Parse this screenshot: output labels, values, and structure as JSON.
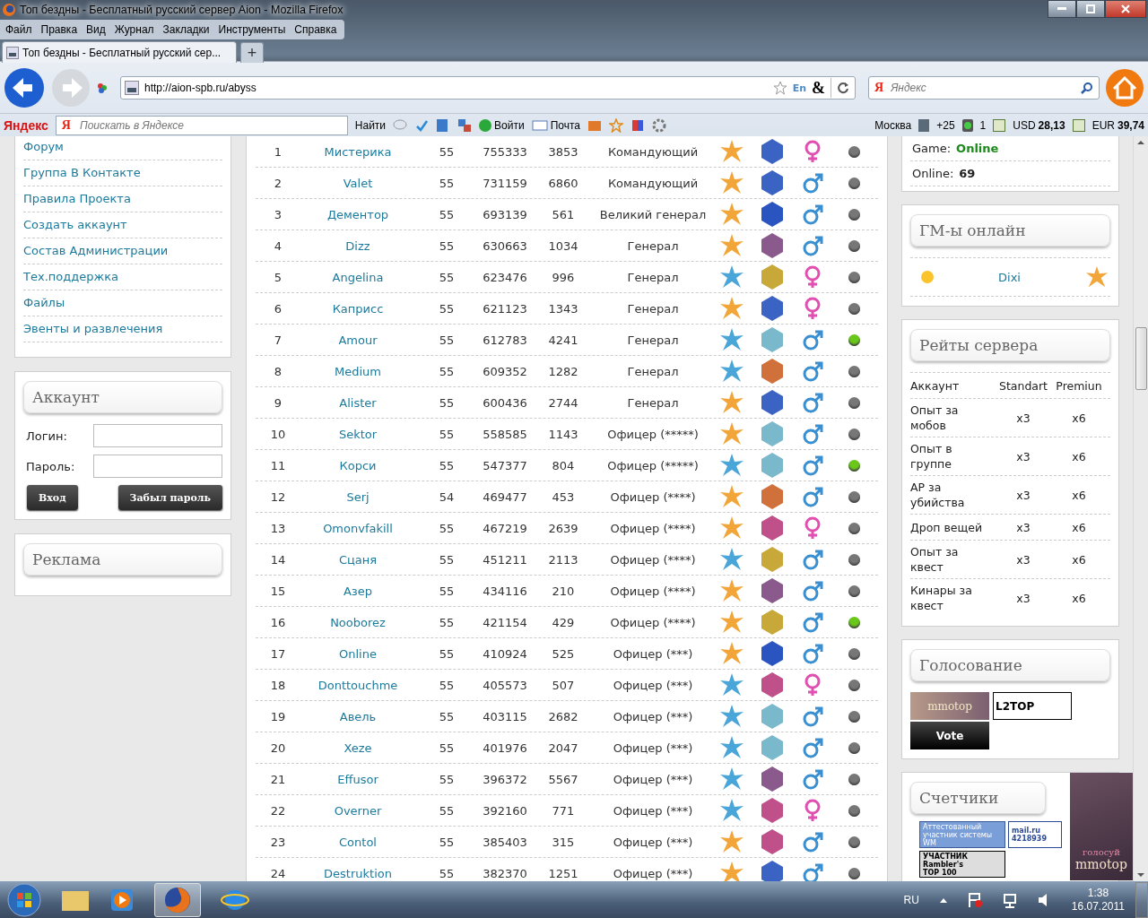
{
  "window": {
    "title": "Топ бездны - Бесплатный русский сервер Aion - Mozilla Firefox"
  },
  "menu": [
    "Файл",
    "Правка",
    "Вид",
    "Журнал",
    "Закладки",
    "Инструменты",
    "Справка"
  ],
  "tabs": [
    {
      "label": "Топ бездны - Бесплатный русский сер...",
      "selected": true
    }
  ],
  "new_tab": "+",
  "address": {
    "value": "http://aion-spb.ru/abyss",
    "lang": "En",
    "amp": "&"
  },
  "search": {
    "placeholder": "Яндекс",
    "logo": "Я"
  },
  "yandex_bar": {
    "logo": "Яндекс",
    "logo_letter": "Я",
    "search_placeholder": "Поискать в Яндексе",
    "find": "Найти",
    "login": "Войти",
    "mail": "Почта",
    "city": "Москва",
    "temp": "+25",
    "traffic": "1",
    "usd_label": "USD",
    "usd": "28,13",
    "eur_label": "EUR",
    "eur": "39,74"
  },
  "nav_links": [
    "Форум",
    "Группа В Контакте",
    "Правила Проекта",
    "Создать аккаунт",
    "Состав Администрации",
    "Тех.поддержка",
    "Файлы",
    "Эвенты и развлечения"
  ],
  "login_box": {
    "title": "Аккаунт",
    "login_label": "Логин:",
    "password_label": "Пароль:",
    "login_button": "Вход",
    "forgot_button": "Забыл пароль"
  },
  "ads_box": {
    "title": "Реклама"
  },
  "table": {
    "rows": [
      {
        "rank": "1",
        "name": "Мистерика",
        "level": "55",
        "ap": "755333",
        "kills": "3853",
        "title": "Командующий",
        "light_side": true,
        "color": "#3b63c4",
        "female": true,
        "online": false
      },
      {
        "rank": "2",
        "name": "Valet",
        "level": "55",
        "ap": "731159",
        "kills": "6860",
        "title": "Командующий",
        "light_side": true,
        "color": "#3b63c4",
        "female": false,
        "online": false
      },
      {
        "rank": "3",
        "name": "Дементор",
        "level": "55",
        "ap": "693139",
        "kills": "561",
        "title": "Великий генерал",
        "light_side": true,
        "color": "#2a55c0",
        "female": false,
        "online": false
      },
      {
        "rank": "4",
        "name": "Dizz",
        "level": "55",
        "ap": "630663",
        "kills": "1034",
        "title": "Генерал",
        "light_side": true,
        "color": "#8a5a8c",
        "female": false,
        "online": false
      },
      {
        "rank": "5",
        "name": "Angelina",
        "level": "55",
        "ap": "623476",
        "kills": "996",
        "title": "Генерал",
        "light_side": false,
        "color": "#c9a83a",
        "female": true,
        "online": false
      },
      {
        "rank": "6",
        "name": "Каприсс",
        "level": "55",
        "ap": "621123",
        "kills": "1343",
        "title": "Генерал",
        "light_side": true,
        "color": "#3b63c4",
        "female": true,
        "online": false
      },
      {
        "rank": "7",
        "name": "Amour",
        "level": "55",
        "ap": "612783",
        "kills": "4241",
        "title": "Генерал",
        "light_side": false,
        "color": "#7ab8cc",
        "female": false,
        "online": true
      },
      {
        "rank": "8",
        "name": "Medium",
        "level": "55",
        "ap": "609352",
        "kills": "1282",
        "title": "Генерал",
        "light_side": false,
        "color": "#d0703a",
        "female": false,
        "online": false
      },
      {
        "rank": "9",
        "name": "Alister",
        "level": "55",
        "ap": "600436",
        "kills": "2744",
        "title": "Генерал",
        "light_side": true,
        "color": "#3b63c4",
        "female": false,
        "online": false
      },
      {
        "rank": "10",
        "name": "Sektor",
        "level": "55",
        "ap": "558585",
        "kills": "1143",
        "title": "Офицер (*****)",
        "light_side": true,
        "color": "#7ab8cc",
        "female": false,
        "online": false
      },
      {
        "rank": "11",
        "name": "Корси",
        "level": "55",
        "ap": "547377",
        "kills": "804",
        "title": "Офицер (*****)",
        "light_side": false,
        "color": "#7ab8cc",
        "female": false,
        "online": true
      },
      {
        "rank": "12",
        "name": "Serj",
        "level": "54",
        "ap": "469477",
        "kills": "453",
        "title": "Офицер (****)",
        "light_side": true,
        "color": "#d0703a",
        "female": false,
        "online": false
      },
      {
        "rank": "13",
        "name": "Omonvfakill",
        "level": "55",
        "ap": "467219",
        "kills": "2639",
        "title": "Офицер (****)",
        "light_side": true,
        "color": "#c0508a",
        "female": true,
        "online": false
      },
      {
        "rank": "14",
        "name": "Сцаня",
        "level": "55",
        "ap": "451211",
        "kills": "2113",
        "title": "Офицер (****)",
        "light_side": false,
        "color": "#c9a83a",
        "female": false,
        "online": false
      },
      {
        "rank": "15",
        "name": "Азер",
        "level": "55",
        "ap": "434116",
        "kills": "210",
        "title": "Офицер (****)",
        "light_side": true,
        "color": "#8a5a8c",
        "female": false,
        "online": false
      },
      {
        "rank": "16",
        "name": "Nooborez",
        "level": "55",
        "ap": "421154",
        "kills": "429",
        "title": "Офицер (****)",
        "light_side": true,
        "color": "#c9a83a",
        "female": false,
        "online": true
      },
      {
        "rank": "17",
        "name": "Online",
        "level": "55",
        "ap": "410924",
        "kills": "525",
        "title": "Офицер (***)",
        "light_side": true,
        "color": "#2a55c0",
        "female": false,
        "online": false
      },
      {
        "rank": "18",
        "name": "Donttouchme",
        "level": "55",
        "ap": "405573",
        "kills": "507",
        "title": "Офицер (***)",
        "light_side": false,
        "color": "#c0508a",
        "female": true,
        "online": false
      },
      {
        "rank": "19",
        "name": "Авель",
        "level": "55",
        "ap": "403115",
        "kills": "2682",
        "title": "Офицер (***)",
        "light_side": false,
        "color": "#7ab8cc",
        "female": false,
        "online": false
      },
      {
        "rank": "20",
        "name": "Xeze",
        "level": "55",
        "ap": "401976",
        "kills": "2047",
        "title": "Офицер (***)",
        "light_side": false,
        "color": "#7ab8cc",
        "female": false,
        "online": false
      },
      {
        "rank": "21",
        "name": "Effusor",
        "level": "55",
        "ap": "396372",
        "kills": "5567",
        "title": "Офицер (***)",
        "light_side": false,
        "color": "#8a5a8c",
        "female": false,
        "online": false
      },
      {
        "rank": "22",
        "name": "Overner",
        "level": "55",
        "ap": "392160",
        "kills": "771",
        "title": "Офицер (***)",
        "light_side": false,
        "color": "#c0508a",
        "female": true,
        "online": false
      },
      {
        "rank": "23",
        "name": "Contol",
        "level": "55",
        "ap": "385403",
        "kills": "315",
        "title": "Офицер (***)",
        "light_side": true,
        "color": "#c0508a",
        "female": false,
        "online": false
      },
      {
        "rank": "24",
        "name": "Destruktion",
        "level": "55",
        "ap": "382370",
        "kills": "1251",
        "title": "Офицер (***)",
        "light_side": true,
        "color": "#3b63c4",
        "female": false,
        "online": false
      }
    ]
  },
  "status_box": {
    "game_label": "Game:",
    "game_value": "Online",
    "online_label": "Online:",
    "online_value": "69"
  },
  "gm_box": {
    "title": "ГМ-ы онлайн",
    "gms": [
      {
        "name": "Dixi",
        "light_side": true
      }
    ]
  },
  "rates": {
    "title": "Рейты сервера",
    "columns": [
      "Аккаунт",
      "Standart",
      "Premiun"
    ],
    "rows": [
      [
        "Опыт за мобов",
        "x3",
        "x6"
      ],
      [
        "Опыт в группе",
        "x3",
        "x6"
      ],
      [
        "AP за убийства",
        "x3",
        "x6"
      ],
      [
        "Дроп вещей",
        "x3",
        "x6"
      ],
      [
        "Опыт за квест",
        "x3",
        "x6"
      ],
      [
        "Кинары за квест",
        "x3",
        "x6"
      ]
    ]
  },
  "vote": {
    "title": "Голосование",
    "banners": [
      {
        "kind": "mmotop",
        "lines": [
          "mmotop"
        ]
      },
      {
        "kind": "l2top",
        "lines": [
          "L2TOP"
        ]
      },
      {
        "kind": "topaion",
        "lines": [
          "Vote"
        ]
      }
    ]
  },
  "counters": {
    "title": "Счетчики",
    "banners": [
      {
        "kind": "wm",
        "lines": [
          "Аттестованный",
          "участник системы",
          "WM"
        ]
      },
      {
        "kind": "mail",
        "lines": [
          "mail.ru",
          "4218939"
        ]
      },
      {
        "kind": "rambler",
        "lines": [
          "УЧАСТНИК",
          "Rambler's",
          "TOP 100"
        ]
      }
    ],
    "overlay": {
      "lines": [
        "голосуй",
        "mmotop"
      ]
    }
  },
  "taskbar": {
    "lang": "RU",
    "time": "1:38",
    "date": "16.07.2011"
  }
}
